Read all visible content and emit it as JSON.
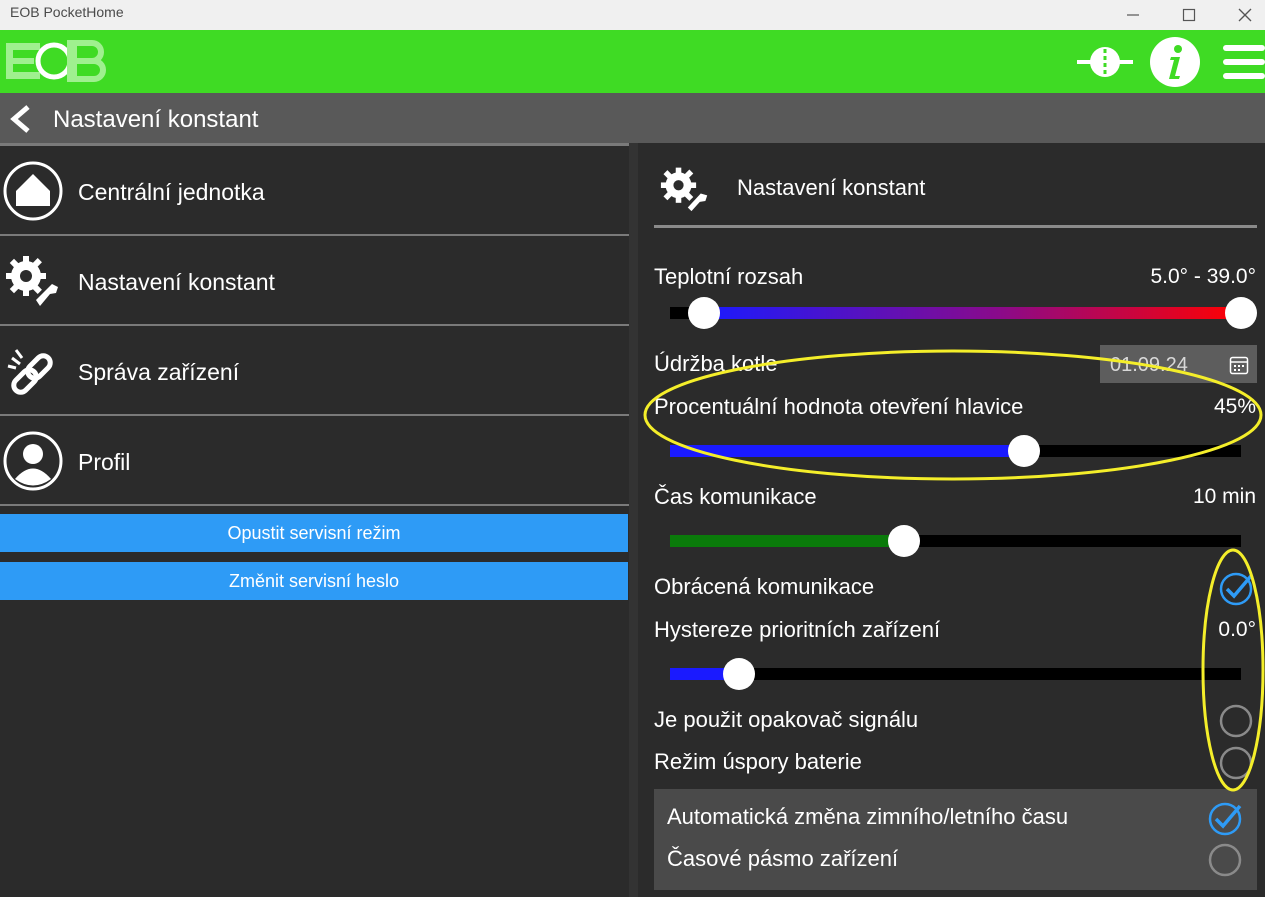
{
  "window": {
    "title": "EOB PocketHome",
    "controls": [
      "minimize-icon",
      "maximize-icon",
      "close-icon"
    ]
  },
  "appbar": {
    "logo_text": "EOB",
    "icons": [
      "connection-icon",
      "info-icon",
      "menu-icon"
    ],
    "brand_color": "#3fdb24"
  },
  "page": {
    "title": "Nastavení konstant"
  },
  "sidebar": {
    "items": [
      {
        "label": "Centrální jednotka",
        "icon": "home-icon"
      },
      {
        "label": "Nastavení konstant",
        "icon": "gears-wrench-icon"
      },
      {
        "label": "Správa zařízení",
        "icon": "chain-link-icon"
      },
      {
        "label": "Profil",
        "icon": "user-icon"
      }
    ],
    "buttons": {
      "leave_service": "Opustit servisní režim",
      "change_password": "Změnit servisní heslo"
    },
    "button_color": "#2e9bf6"
  },
  "settings": {
    "title": "Nastavení konstant",
    "temp_range": {
      "label": "Teplotní rozsah",
      "value": "5.0° - 39.0°",
      "low_fraction": 0.06,
      "high_fraction": 1.0
    },
    "maintenance": {
      "label": "Údržba kotle",
      "date": "01.09.24"
    },
    "valve_open": {
      "label": "Procentuální hodnota otevření hlavice",
      "value": "45%",
      "fraction": 0.62
    },
    "comm_time": {
      "label": "Čas komunikace",
      "value": "10 min",
      "fraction": 0.41
    },
    "reverse_comm": {
      "label": "Obrácená komunikace",
      "checked": true
    },
    "hysteresis": {
      "label": "Hystereze prioritních zařízení",
      "value": "0.0°",
      "fraction": 0.12
    },
    "repeater": {
      "label": "Je použit opakovač signálu",
      "checked": false
    },
    "battery_saving": {
      "label": "Režim úspory baterie",
      "checked": false
    },
    "auto_dst": {
      "label": "Automatická změna zimního/letního času",
      "checked": true
    },
    "timezone": {
      "label": "Časové pásmo zařízení",
      "checked": false
    }
  },
  "colors": {
    "slider_blue": "#1a1aff",
    "slider_green": "#0a7a0a",
    "slider_red": "#ff0000",
    "annotation_yellow": "#f4ee2a",
    "check_blue": "#2e9bf6"
  }
}
